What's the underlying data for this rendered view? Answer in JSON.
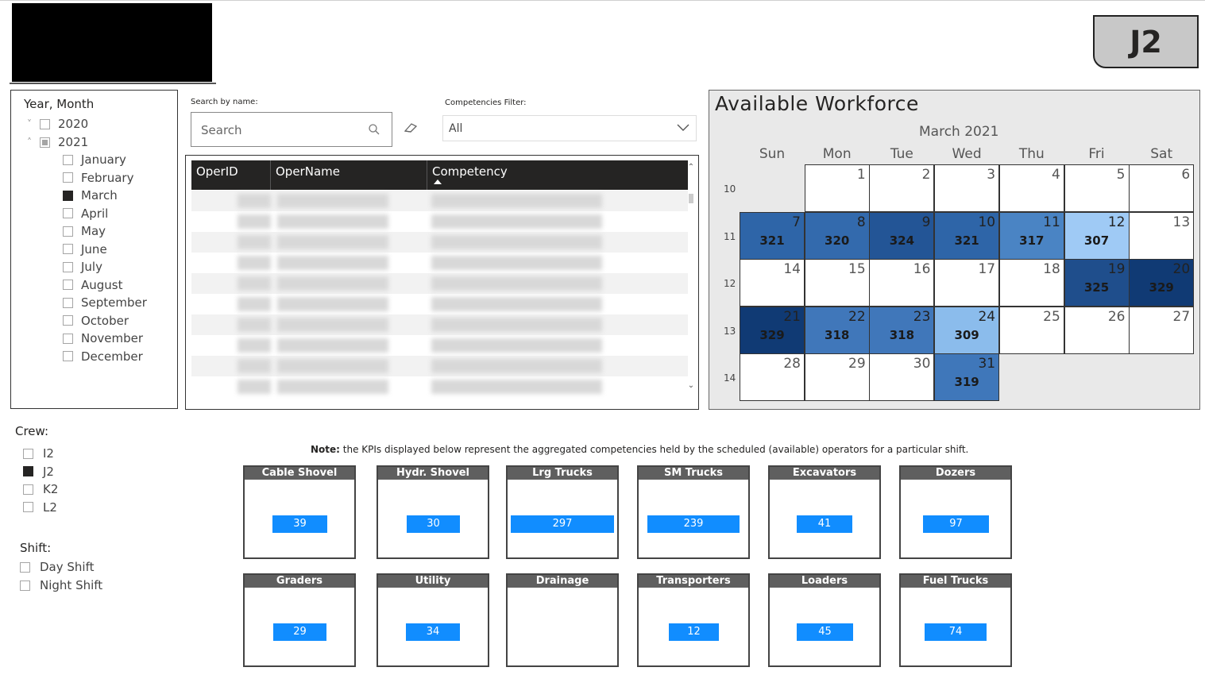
{
  "crew_badge": "J2",
  "year_month_slicer": {
    "title": "Year, Month",
    "years": [
      {
        "label": "2020",
        "state": "unchecked",
        "expanded": false
      },
      {
        "label": "2021",
        "state": "partial",
        "expanded": true
      }
    ],
    "months": [
      {
        "label": "January",
        "checked": false
      },
      {
        "label": "February",
        "checked": false
      },
      {
        "label": "March",
        "checked": true
      },
      {
        "label": "April",
        "checked": false
      },
      {
        "label": "May",
        "checked": false
      },
      {
        "label": "June",
        "checked": false
      },
      {
        "label": "July",
        "checked": false
      },
      {
        "label": "August",
        "checked": false
      },
      {
        "label": "September",
        "checked": false
      },
      {
        "label": "October",
        "checked": false
      },
      {
        "label": "November",
        "checked": false
      },
      {
        "label": "December",
        "checked": false
      }
    ]
  },
  "search": {
    "label": "Search by name:",
    "placeholder": "Search"
  },
  "competencies_filter": {
    "label": "Competencies Filter:",
    "value": "All"
  },
  "table": {
    "columns": [
      "OperID",
      "OperName",
      "Competency"
    ],
    "sorted_column": "Competency",
    "rows_visible": 10
  },
  "calendar": {
    "title": "Available Workforce",
    "month": "March 2021",
    "weekdays": [
      "Sun",
      "Mon",
      "Tue",
      "Wed",
      "Thu",
      "Fri",
      "Sat"
    ],
    "weeks": [
      {
        "week": "10",
        "days": [
          null,
          {
            "d": "1"
          },
          {
            "d": "2"
          },
          {
            "d": "3"
          },
          {
            "d": "4"
          },
          {
            "d": "5"
          },
          {
            "d": "6"
          }
        ]
      },
      {
        "week": "11",
        "days": [
          {
            "d": "7",
            "v": "321",
            "c": "#2e65a8"
          },
          {
            "d": "8",
            "v": "320",
            "c": "#336aad"
          },
          {
            "d": "9",
            "v": "324",
            "c": "#235596"
          },
          {
            "d": "10",
            "v": "321",
            "c": "#2e65a8"
          },
          {
            "d": "11",
            "v": "317",
            "c": "#4a84c4"
          },
          {
            "d": "12",
            "v": "307",
            "c": "#9fcaf5"
          },
          {
            "d": "13"
          }
        ]
      },
      {
        "week": "12",
        "days": [
          {
            "d": "14"
          },
          {
            "d": "15"
          },
          {
            "d": "16"
          },
          {
            "d": "17"
          },
          {
            "d": "18"
          },
          {
            "d": "19",
            "v": "325",
            "c": "#1f4e8c"
          },
          {
            "d": "20",
            "v": "329",
            "c": "#103a74"
          }
        ]
      },
      {
        "week": "13",
        "days": [
          {
            "d": "21",
            "v": "329",
            "c": "#103a74"
          },
          {
            "d": "22",
            "v": "318",
            "c": "#4077ba"
          },
          {
            "d": "23",
            "v": "318",
            "c": "#4077ba"
          },
          {
            "d": "24",
            "v": "309",
            "c": "#8bbcec"
          },
          {
            "d": "25"
          },
          {
            "d": "26"
          },
          {
            "d": "27"
          }
        ]
      },
      {
        "week": "14",
        "days": [
          {
            "d": "28"
          },
          {
            "d": "29"
          },
          {
            "d": "30"
          },
          {
            "d": "31",
            "v": "319",
            "c": "#3f77ba"
          },
          null,
          null,
          null
        ]
      }
    ]
  },
  "crew": {
    "title": "Crew:",
    "options": [
      {
        "label": "I2",
        "checked": false
      },
      {
        "label": "J2",
        "checked": true
      },
      {
        "label": "K2",
        "checked": false
      },
      {
        "label": "L2",
        "checked": false
      }
    ]
  },
  "shift": {
    "title": "Shift:",
    "options": [
      {
        "label": "Day Shift",
        "checked": false
      },
      {
        "label": "Night Shift",
        "checked": false
      }
    ]
  },
  "note": {
    "bold": "Note:",
    "text": " the KPIs displayed below represent the aggregated competencies held by the scheduled (available) operators for a particular shift."
  },
  "kpis": [
    {
      "title": "Cable Shovel",
      "value": "39",
      "fill": 0.13
    },
    {
      "title": "Hydr. Shovel",
      "value": "30",
      "fill": 0.1
    },
    {
      "title": "Lrg Trucks",
      "value": "297",
      "fill": 1.0
    },
    {
      "title": "SM Trucks",
      "value": "239",
      "fill": 0.8
    },
    {
      "title": "Excavators",
      "value": "41",
      "fill": 0.14
    },
    {
      "title": "Dozers",
      "value": "97",
      "fill": 0.33
    },
    {
      "title": "Graders",
      "value": "29",
      "fill": 0.1
    },
    {
      "title": "Utility",
      "value": "34",
      "fill": 0.11
    },
    {
      "title": "Drainage",
      "value": "",
      "fill": 0
    },
    {
      "title": "Transporters",
      "value": "12",
      "fill": 0.04
    },
    {
      "title": "Loaders",
      "value": "45",
      "fill": 0.15
    },
    {
      "title": "Fuel Trucks",
      "value": "74",
      "fill": 0.25
    }
  ],
  "colors": {
    "kpi_bar": "#118dff",
    "kpi_header": "#5f5f5f",
    "table_header": "#252423"
  }
}
